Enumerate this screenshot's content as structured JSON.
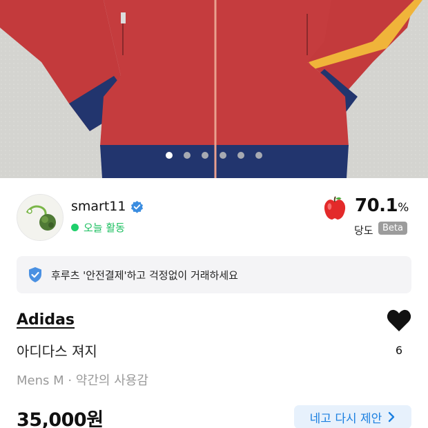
{
  "gallery": {
    "page_count": 6,
    "active_index": 0
  },
  "seller": {
    "name": "smart11",
    "activity": "오늘 활동",
    "activity_color": "#1fcf6b",
    "sweetness": {
      "value": "70.1",
      "unit": "%",
      "label": "당도",
      "badge": "Beta"
    }
  },
  "safe_pay": {
    "text": "후루츠 '안전결제'하고 걱정없이 거래하세요",
    "icon": "shield-check-icon",
    "accent": "#4a90e2"
  },
  "product": {
    "brand": "Adidas",
    "title": "아디다스 져지",
    "meta": "Mens M · 약간의 사용감",
    "price": "35,000원",
    "likes": "6"
  },
  "offer_button": {
    "label": "네고 다시 제안",
    "color": "#1a7fe0",
    "background": "#e7f1fc"
  }
}
